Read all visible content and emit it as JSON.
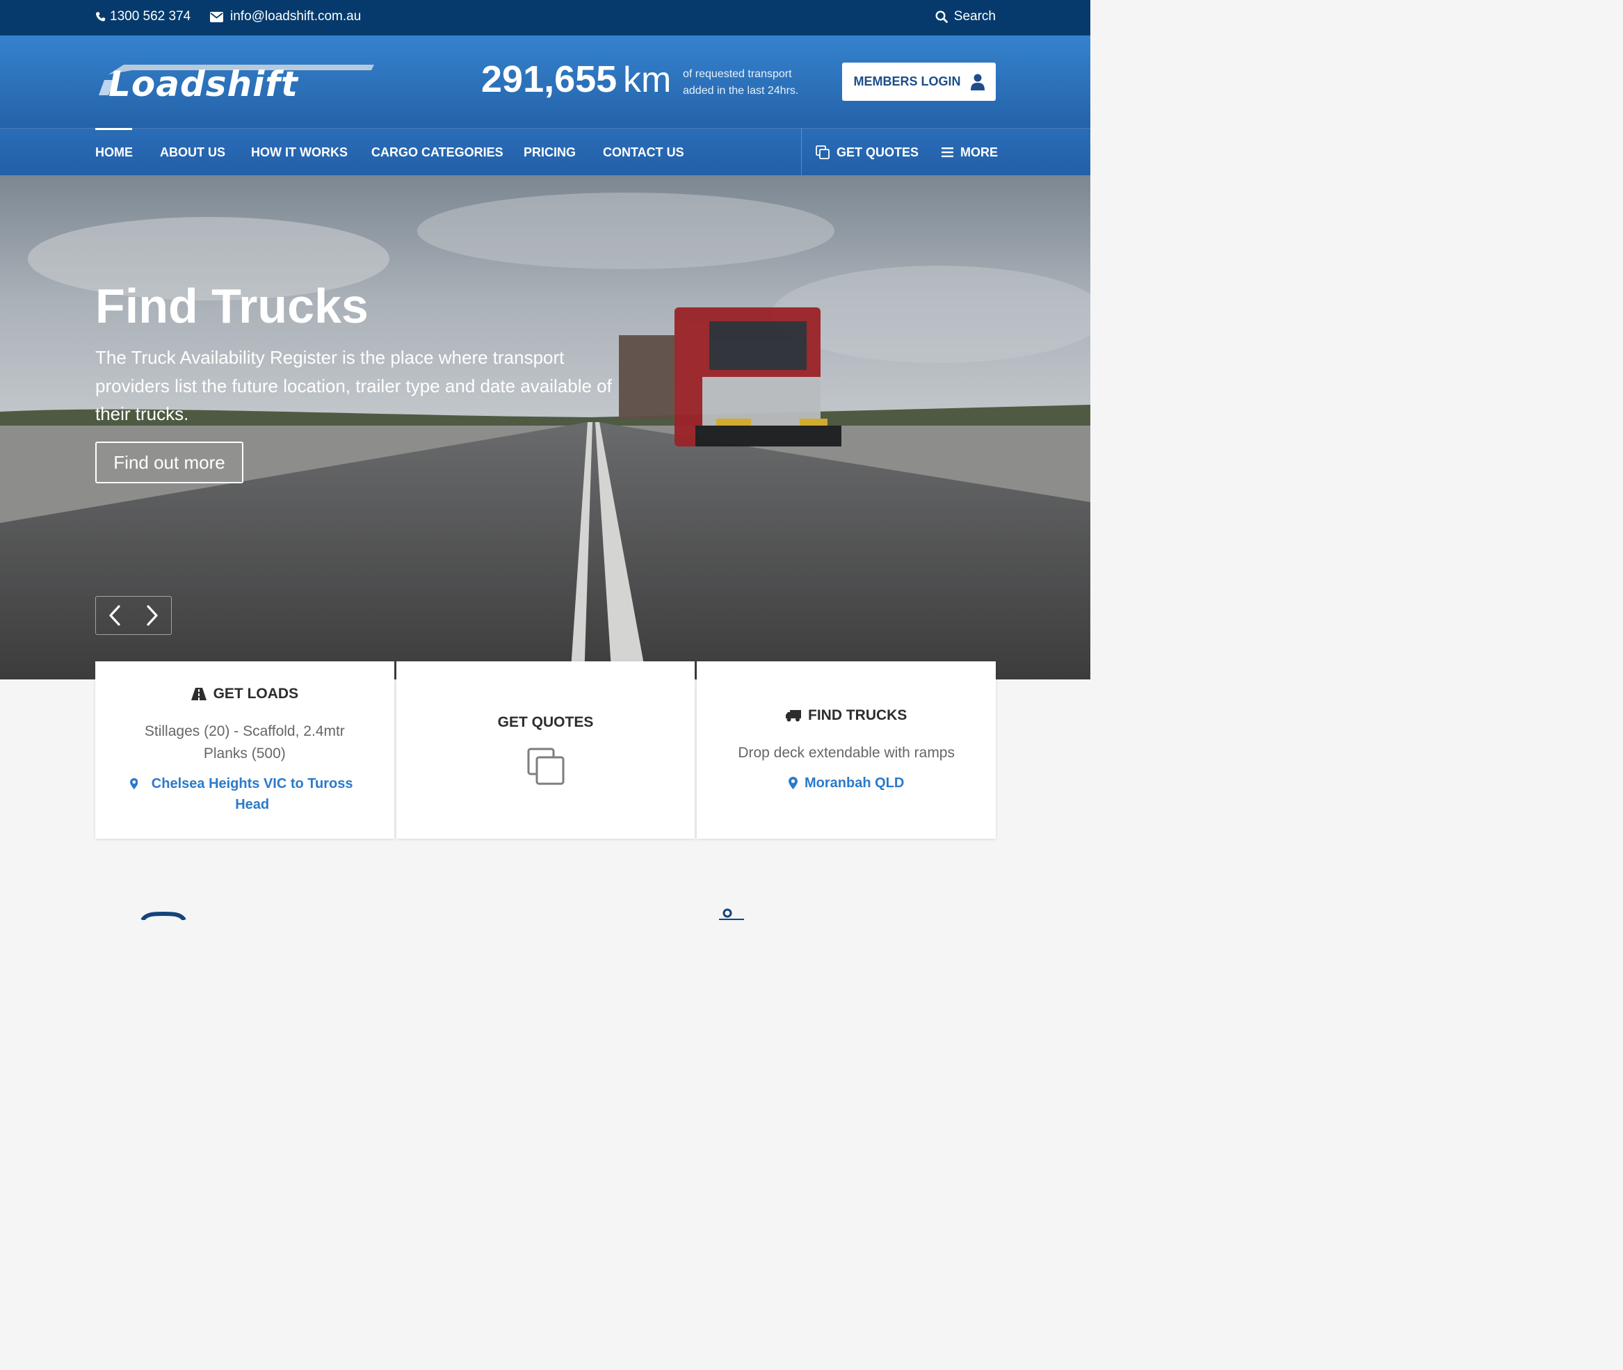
{
  "topbar": {
    "phone": "1300 562 374",
    "email": "info@loadshift.com.au",
    "search_label": "Search"
  },
  "header": {
    "logo_text": "Loadshift",
    "stat_value": "291,655",
    "stat_unit": "km",
    "stat_desc_line1": "of requested transport",
    "stat_desc_line2": "added in the last 24hrs.",
    "login_label": "MEMBERS LOGIN"
  },
  "nav": {
    "items": [
      "HOME",
      "ABOUT US",
      "HOW IT WORKS",
      "CARGO CATEGORIES",
      "PRICING",
      "CONTACT US"
    ],
    "get_quotes": "GET QUOTES",
    "more": "MORE"
  },
  "hero": {
    "title": "Find Trucks",
    "text": "The Truck Availability Register is the place where transport providers list the future location, trailer type and date available of their trucks.",
    "button": "Find out more"
  },
  "cards": {
    "loads": {
      "title": "GET LOADS",
      "desc": "Stillages (20) - Scaffold, 2.4mtr Planks (500)",
      "location": "Chelsea Heights VIC to Tuross Head"
    },
    "quotes": {
      "title": "GET QUOTES"
    },
    "trucks": {
      "title": "FIND TRUCKS",
      "desc": "Drop deck extendable with ramps",
      "location": "Moranbah QLD"
    }
  },
  "colors": {
    "topbar": "#063a6c",
    "header": "#2c70bd",
    "accent_link": "#2b7ac9",
    "login_text": "#1d4e89"
  },
  "icons": [
    "phone-icon",
    "envelope-icon",
    "search-icon",
    "user-icon",
    "copy-icon",
    "menu-icon",
    "road-icon",
    "truck-icon",
    "map-marker-icon",
    "chevron-left-icon",
    "chevron-right-icon"
  ]
}
